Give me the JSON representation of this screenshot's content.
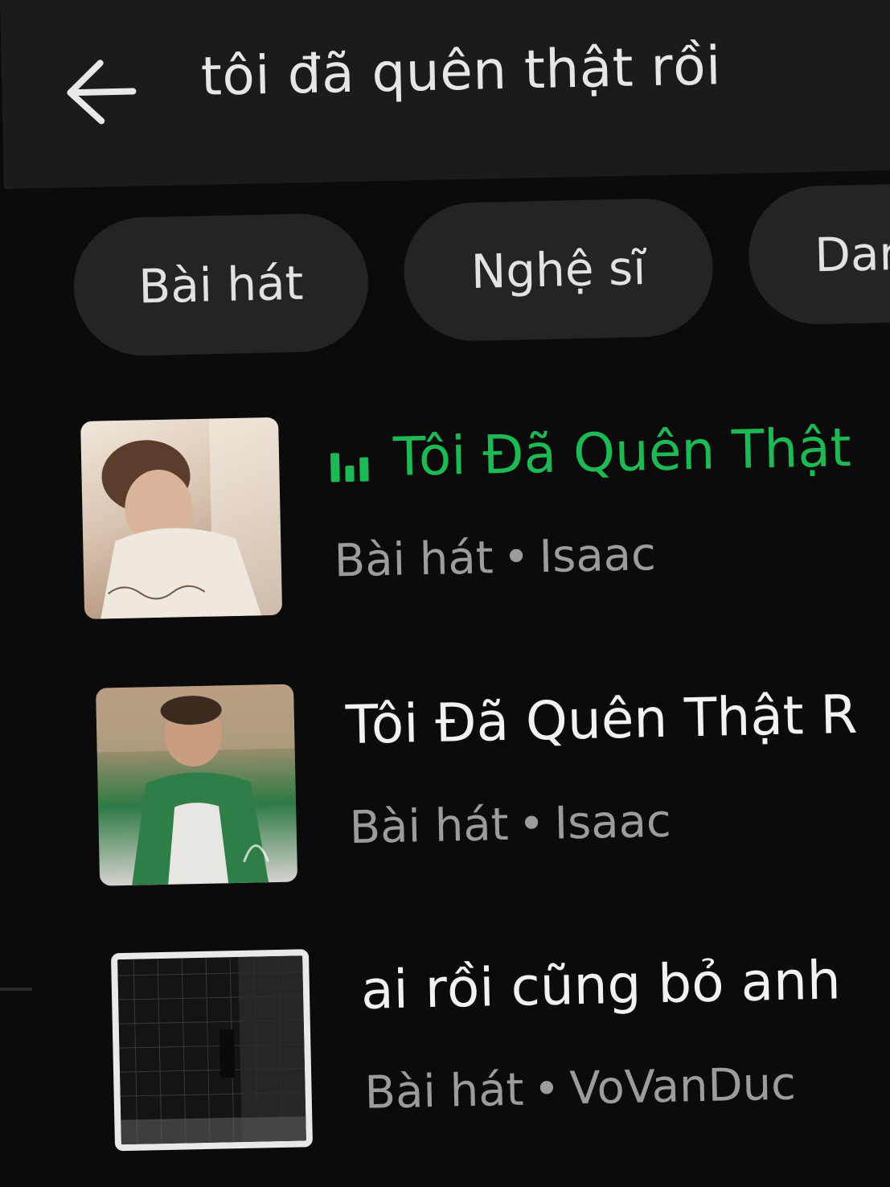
{
  "header": {
    "back_icon": "arrow-left-icon",
    "query": "tôi đã quên thật rồi"
  },
  "filters": [
    {
      "label": "Bài hát"
    },
    {
      "label": "Nghệ sĩ"
    },
    {
      "label": "Dar"
    }
  ],
  "results": [
    {
      "title": "Tôi Đã Quên Thật",
      "type": "Bài hát",
      "separator": "•",
      "artist": "Isaac",
      "playing": true,
      "playing_icon": "equalizer-icon",
      "accent": "#1db954"
    },
    {
      "title": "Tôi Đã Quên Thật R",
      "type": "Bài hát",
      "separator": "•",
      "artist": "Isaac",
      "playing": false
    },
    {
      "title": "ai rồi cũng bỏ anh",
      "type": "Bài hát",
      "separator": "•",
      "artist": "VoVanDuc",
      "playing": false
    }
  ]
}
